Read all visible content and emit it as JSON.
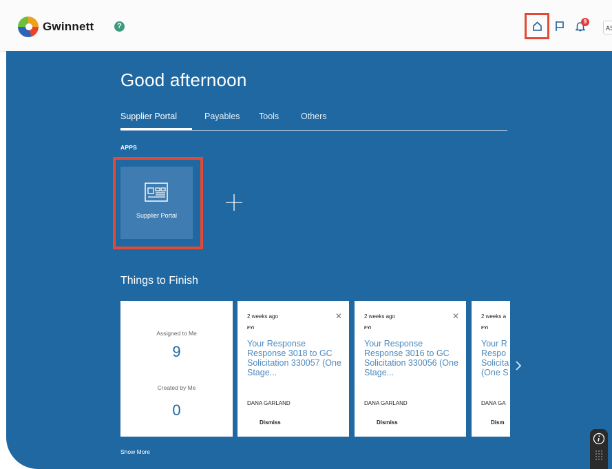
{
  "header": {
    "brand": "Gwinnett",
    "help_label": "?",
    "notifications_count": "9",
    "user_initials": "AS"
  },
  "main": {
    "greeting": "Good afternoon",
    "tabs": [
      {
        "label": "Supplier Portal",
        "active": true
      },
      {
        "label": "Payables"
      },
      {
        "label": "Tools"
      },
      {
        "label": "Others"
      }
    ],
    "apps_label": "APPS",
    "apps": [
      {
        "label": "Supplier Portal",
        "icon": "portal-icon"
      }
    ],
    "things_to_finish_title": "Things to Finish",
    "summary": {
      "assigned_label": "Assigned to Me",
      "assigned_count": "9",
      "created_label": "Created by Me",
      "created_count": "0"
    },
    "tasks": [
      {
        "time": "2 weeks ago",
        "tag": "FYI",
        "title": "Your Response Response 3018 to GC Solicitation 330057 (One Stage...",
        "person": "DANA GARLAND",
        "action": "Dismiss"
      },
      {
        "time": "2 weeks ago",
        "tag": "FYI",
        "title": "Your Response Response 3016 to GC Solicitation 330056 (One Stage...",
        "person": "DANA GARLAND",
        "action": "Dismiss"
      },
      {
        "time": "2 weeks a",
        "tag": "FYI",
        "title": "Your R Respo Solicita (One S",
        "person": "DANA GA",
        "action": "Dism"
      }
    ],
    "show_more": "Show More"
  },
  "colors": {
    "accent": "#1f68a2",
    "highlight": "#e34a33",
    "link": "#4d89be"
  }
}
